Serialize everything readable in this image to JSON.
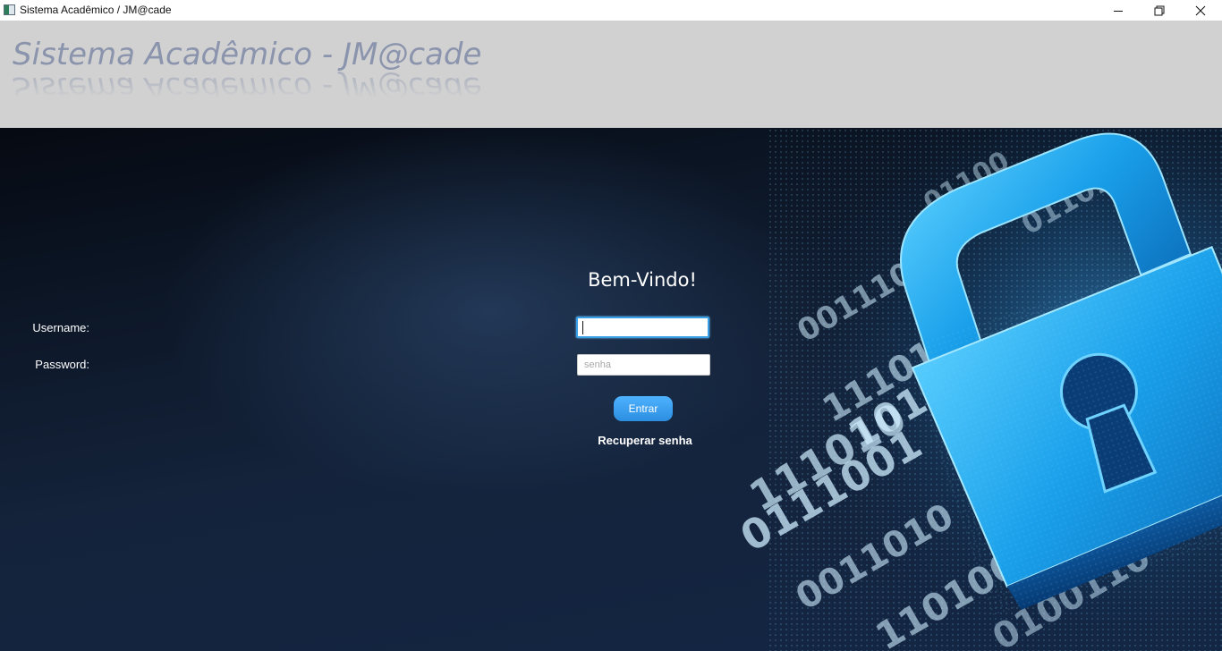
{
  "window": {
    "title": "Sistema Acadêmico / JM@cade",
    "icons": {
      "app": "app-icon",
      "minimize": "minimize-icon",
      "maximize": "restore-icon",
      "close": "close-icon"
    }
  },
  "banner": {
    "title": "Sistema Acadêmico - JM@cade",
    "color": "#8b94ad",
    "background": "#d1d1d1"
  },
  "background_art": {
    "lock_icon": "padlock-icon",
    "binary_digits": [
      "0",
      "1",
      "1",
      "0",
      "0",
      "1",
      "1",
      "1",
      "0",
      "1",
      "0",
      "1",
      "1",
      "0",
      "0",
      "0",
      "1",
      "1",
      "0",
      "1",
      "0",
      "0",
      "1",
      "1",
      "1",
      "0",
      "1",
      "0",
      "0",
      "1"
    ]
  },
  "login": {
    "heading": "Bem-Vindo!",
    "username_label": "Username:",
    "username_value": "",
    "password_label": "Password:",
    "password_placeholder": "senha",
    "submit_label": "Entrar",
    "recover_label": "Recuperar senha",
    "accent_color": "#3aa0e6"
  }
}
